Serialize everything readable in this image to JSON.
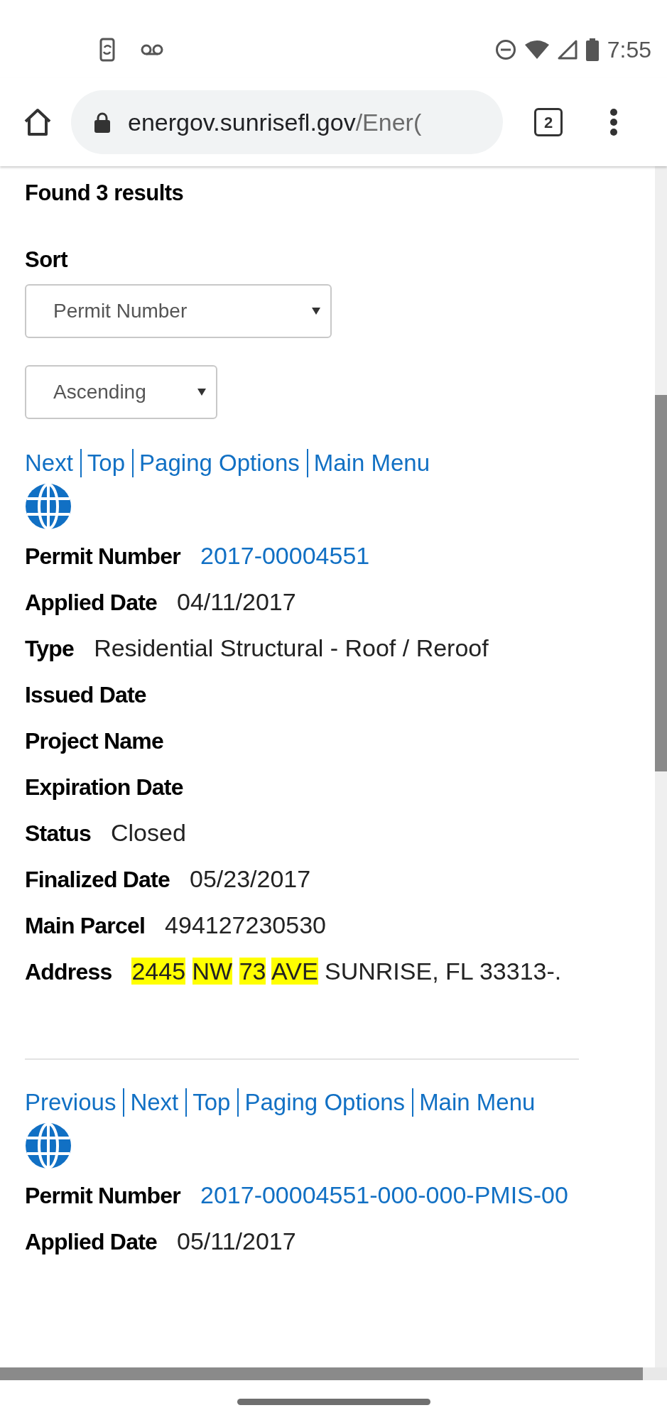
{
  "status_bar": {
    "time": "7:55"
  },
  "browser": {
    "url_host": "energov.sunrisefl.gov",
    "url_path": "/Ener(",
    "tab_count": "2"
  },
  "results": {
    "summary": "Found 3 results",
    "sort_label": "Sort",
    "sort_field": "Permit Number",
    "sort_order": "Ascending"
  },
  "records": [
    {
      "nav_links": [
        "Next",
        "Top",
        "Paging Options",
        "Main Menu"
      ],
      "fields": [
        {
          "label": "Permit Number",
          "kind": "link",
          "value": "2017-00004551"
        },
        {
          "label": "Applied Date",
          "kind": "text",
          "value": "04/11/2017"
        },
        {
          "label": "Type",
          "kind": "text",
          "value": "Residential Structural - Roof / Reroof"
        },
        {
          "label": "Issued Date",
          "kind": "text"
        },
        {
          "label": "Project Name",
          "kind": "text"
        },
        {
          "label": "Expiration Date",
          "kind": "text"
        },
        {
          "label": "Status",
          "kind": "text",
          "value": "Closed"
        },
        {
          "label": "Finalized Date",
          "kind": "text",
          "value": "05/23/2017"
        },
        {
          "label": "Main Parcel",
          "kind": "text",
          "value": "494127230530"
        },
        {
          "label": "Address",
          "kind": "address",
          "segments": [
            {
              "text": "2445",
              "highlighted": true
            },
            {
              "text": "NW",
              "highlighted": true
            },
            {
              "text": "73",
              "highlighted": true
            },
            {
              "text": "AVE",
              "highlighted": true
            },
            {
              "text": "SUNRISE, FL 33313-.",
              "highlighted": false
            }
          ]
        }
      ]
    },
    {
      "nav_links": [
        "Previous",
        "Next",
        "Top",
        "Paging Options",
        "Main Menu"
      ],
      "fields": [
        {
          "label": "Permit Number",
          "kind": "link",
          "value": "2017-00004551-000-000-PMIS-00"
        },
        {
          "label": "Applied Date",
          "kind": "text",
          "value": "05/11/2017"
        }
      ]
    }
  ]
}
